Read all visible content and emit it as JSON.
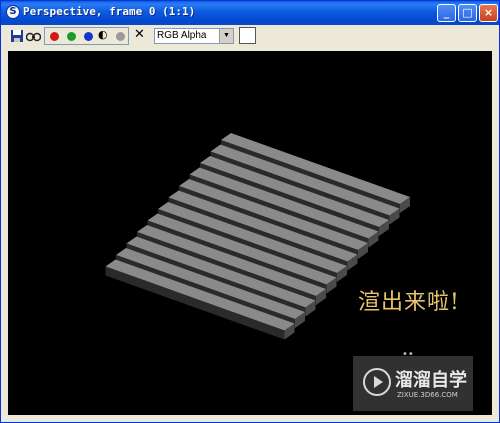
{
  "window": {
    "title": "Perspective, frame 0 (1:1)"
  },
  "titlebar": {
    "minimize": "_",
    "maximize": "□",
    "close": "×",
    "app_icon": "S"
  },
  "toolbar": {
    "save_icon": "save-icon",
    "clone_icon": "clone-icon",
    "channels": [
      {
        "name": "red",
        "color": "#d11919"
      },
      {
        "name": "green",
        "color": "#1d9a2c"
      },
      {
        "name": "blue",
        "color": "#1735c8"
      }
    ],
    "mono_glyph": "◐",
    "clear_glyph": "✕",
    "channel_select": {
      "selected": "RGB Alpha",
      "arrow": "▼"
    },
    "swatch_color": "#ffffff"
  },
  "viewport": {
    "background": "#000000",
    "caption": "渲出来啦!",
    "watermark": {
      "main": "溜溜自学",
      "sub": "ZIXUE.3D66.COM"
    },
    "marks": "•• "
  }
}
